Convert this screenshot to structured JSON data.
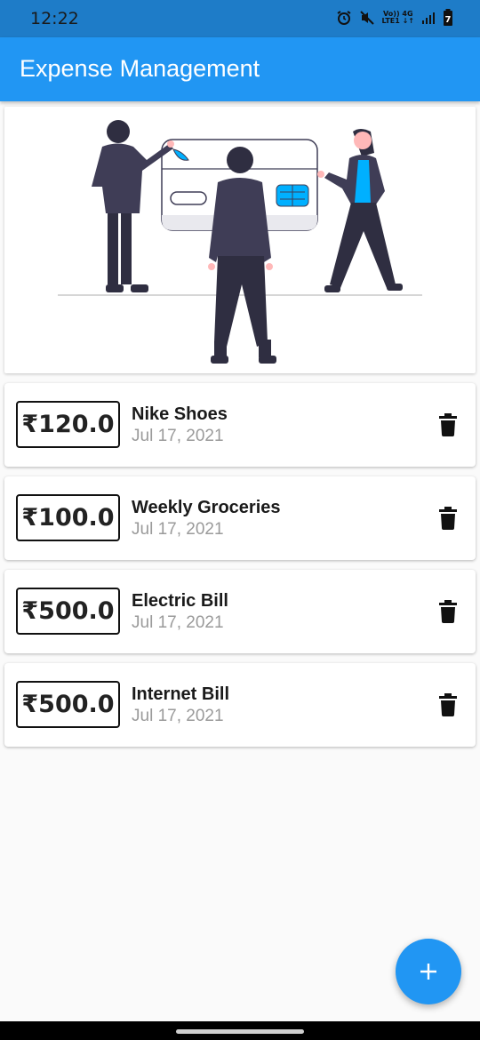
{
  "status_bar": {
    "time": "12:22",
    "net_line1": "Vo)) 4G",
    "net_line2": "LTE1 ↓↑",
    "battery": "7"
  },
  "app_bar": {
    "title": "Expense Management"
  },
  "illustration": {
    "name": "people-with-credit-card-illustration"
  },
  "expenses": [
    {
      "amount": "₹120.0",
      "title": "Nike Shoes",
      "date": "Jul 17, 2021"
    },
    {
      "amount": "₹100.0",
      "title": "Weekly Groceries",
      "date": "Jul 17, 2021"
    },
    {
      "amount": "₹500.0",
      "title": "Electric Bill",
      "date": "Jul 17, 2021"
    },
    {
      "amount": "₹500.0",
      "title": "Internet Bill",
      "date": "Jul 17, 2021"
    }
  ],
  "fab": {
    "icon": "plus-icon"
  },
  "colors": {
    "primary": "#2196f3",
    "status_bar": "#1e7cc8",
    "accent_illustration": "#00b0ff",
    "figure_dark": "#3f3d56"
  }
}
